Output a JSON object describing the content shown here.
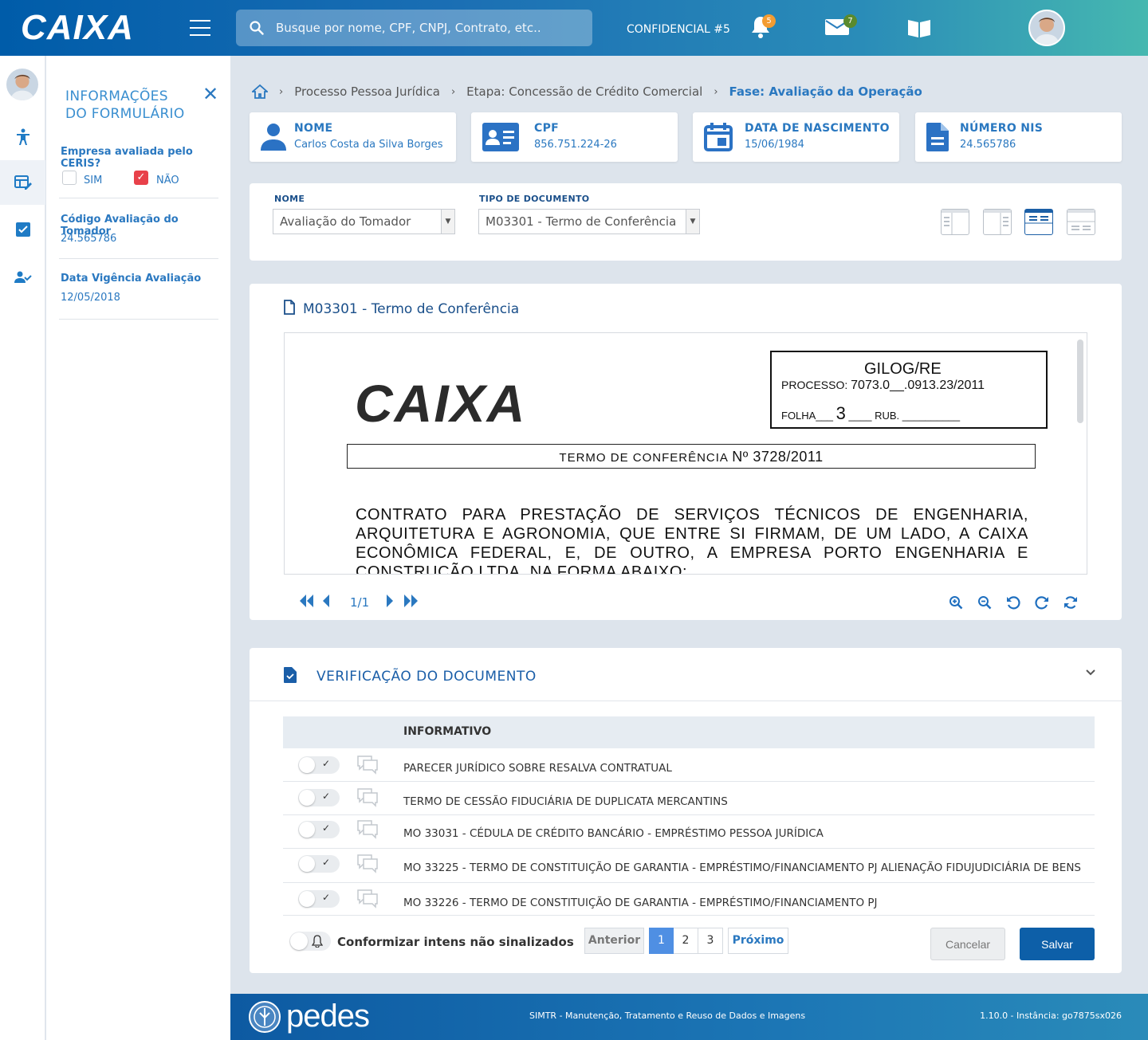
{
  "header": {
    "logo": "CAIXA",
    "search_placeholder": "Busque por nome, CPF, CNPJ, Contrato, etc..",
    "confidential": "CONFIDENCIAL #5",
    "notifications_count": "5",
    "messages_count": "7",
    "colors": {
      "bar_start": "#005ca9",
      "bar_end": "#46b8b0",
      "notif_badge": "#f39c32",
      "msg_badge": "#5a8a2e"
    }
  },
  "form_panel": {
    "title_line1": "INFORMAÇÕES",
    "title_line2": "DO FORMULÁRIO",
    "close": "✕",
    "question": "Empresa avaliada pelo CERIS?",
    "option_yes": "SIM",
    "option_no": "NÃO",
    "selected": "NÃO",
    "code_label": "Código Avaliação do Tomador",
    "code_value": "24.565786",
    "date_label": "Data Vigência Avaliação",
    "date_value": "12/05/2018"
  },
  "breadcrumb": {
    "item1": "Processo Pessoa Jurídica",
    "item2": "Etapa: Concessão de Crédito Comercial",
    "item3": "Fase: Avaliação da Operação"
  },
  "cards": [
    {
      "title": "NOME",
      "value": "Carlos Costa da Silva Borges",
      "icon": "user-icon"
    },
    {
      "title": "CPF",
      "value": "856.751.224-26",
      "icon": "id-card-icon"
    },
    {
      "title": "DATA DE NASCIMENTO",
      "value": "15/06/1984",
      "icon": "calendar-icon"
    },
    {
      "title": "NÚMERO NIS",
      "value": "24.565786",
      "icon": "document-icon"
    }
  ],
  "selectors": {
    "name_label": "NOME",
    "name_value": "Avaliação do Tomador",
    "type_label": "TIPO DE DOCUMENTO",
    "type_value": "M03301 - Termo de Conferência",
    "active_layout": 3
  },
  "viewer": {
    "title": "M03301 - Termo de Conferência",
    "page": "1/1",
    "scan": {
      "logo": "CAIXA",
      "stamp_title": "GILOG/RE",
      "stamp_process_label": "PROCESSO:",
      "stamp_process_value": "7073.0__.0913.23/2011",
      "stamp_folha_label": "FOLHA___",
      "stamp_folha_value": "3",
      "stamp_rub": "____ RUB. __________",
      "term_label": "TERMO DE CONFERÊNCIA",
      "term_number": "Nº 3728/2011",
      "contract_text": "CONTRATO PARA PRESTAÇÃO DE SERVIÇOS TÉCNICOS DE ENGENHARIA, ARQUITETURA E AGRONOMIA, QUE ENTRE SI FIRMAM, DE UM LADO, A CAIXA ECONÔMICA FEDERAL, E, DE OUTRO, A EMPRESA PORTO ENGENHARIA E CONSTRUÇÃO LTDA, NA FORMA ABAIXO:"
    }
  },
  "verification": {
    "title": "VERIFICAÇÃO DO DOCUMENTO",
    "column_header": "INFORMATIVO",
    "rows": [
      "PARECER JURÍDICO SOBRE RESALVA CONTRATUAL",
      "TERMO DE CESSÃO FIDUCIÁRIA DE DUPLICATA MERCANTINS",
      "MO 33031 - CÉDULA DE CRÉDITO BANCÁRIO - EMPRÉSTIMO PESSOA JURÍDICA",
      "MO 33225 - TERMO DE CONSTITUIÇÃO DE GARANTIA - EMPRÉSTIMO/FINANCIAMENTO PJ ALIENAÇÃO FIDUJUDICIÁRIA DE BENS",
      "MO 33226 - TERMO DE CONSTITUIÇÃO DE GARANTIA - EMPRÉSTIMO/FINANCIAMENTO PJ"
    ],
    "check_mark": "✓",
    "conform_label": "Conformizar intens não sinalizados",
    "pager": {
      "prev": "Anterior",
      "p1": "1",
      "p2": "2",
      "p3": "3",
      "next": "Próximo",
      "current": 1
    },
    "cancel": "Cancelar",
    "save": "Salvar"
  },
  "footer": {
    "brand": "pedes",
    "center": "SIMTR - Manutenção, Tratamento e Reuso de Dados e Imagens",
    "right": "1.10.0 - Instância: go7875sx026"
  }
}
